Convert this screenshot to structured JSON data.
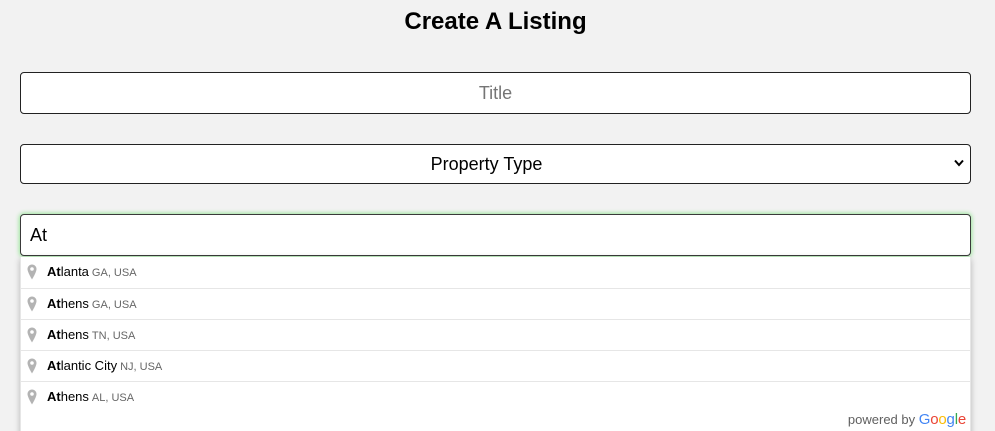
{
  "page": {
    "heading": "Create A Listing"
  },
  "form": {
    "title_placeholder": "Title",
    "property_type_selected": "Property Type",
    "location_value": "At"
  },
  "autocomplete": {
    "suggestions": [
      {
        "match": "At",
        "rest": "lanta",
        "secondary": "GA, USA"
      },
      {
        "match": "At",
        "rest": "hens",
        "secondary": "GA, USA"
      },
      {
        "match": "At",
        "rest": "hens",
        "secondary": "TN, USA"
      },
      {
        "match": "At",
        "rest": "lantic City",
        "secondary": "NJ, USA"
      },
      {
        "match": "At",
        "rest": "hens",
        "secondary": "AL, USA"
      }
    ],
    "powered_by": "powered by",
    "brand_letters": [
      "G",
      "o",
      "o",
      "g",
      "l",
      "e"
    ]
  },
  "colors": {
    "focus_glow": "#9be59b",
    "google_blue": "#4285f4",
    "google_red": "#ea4335",
    "google_yellow": "#fbbc05",
    "google_green": "#34a853"
  },
  "icons": {
    "suggestion_icon": "map-pin-icon",
    "select_icon": "chevron-down-icon"
  }
}
